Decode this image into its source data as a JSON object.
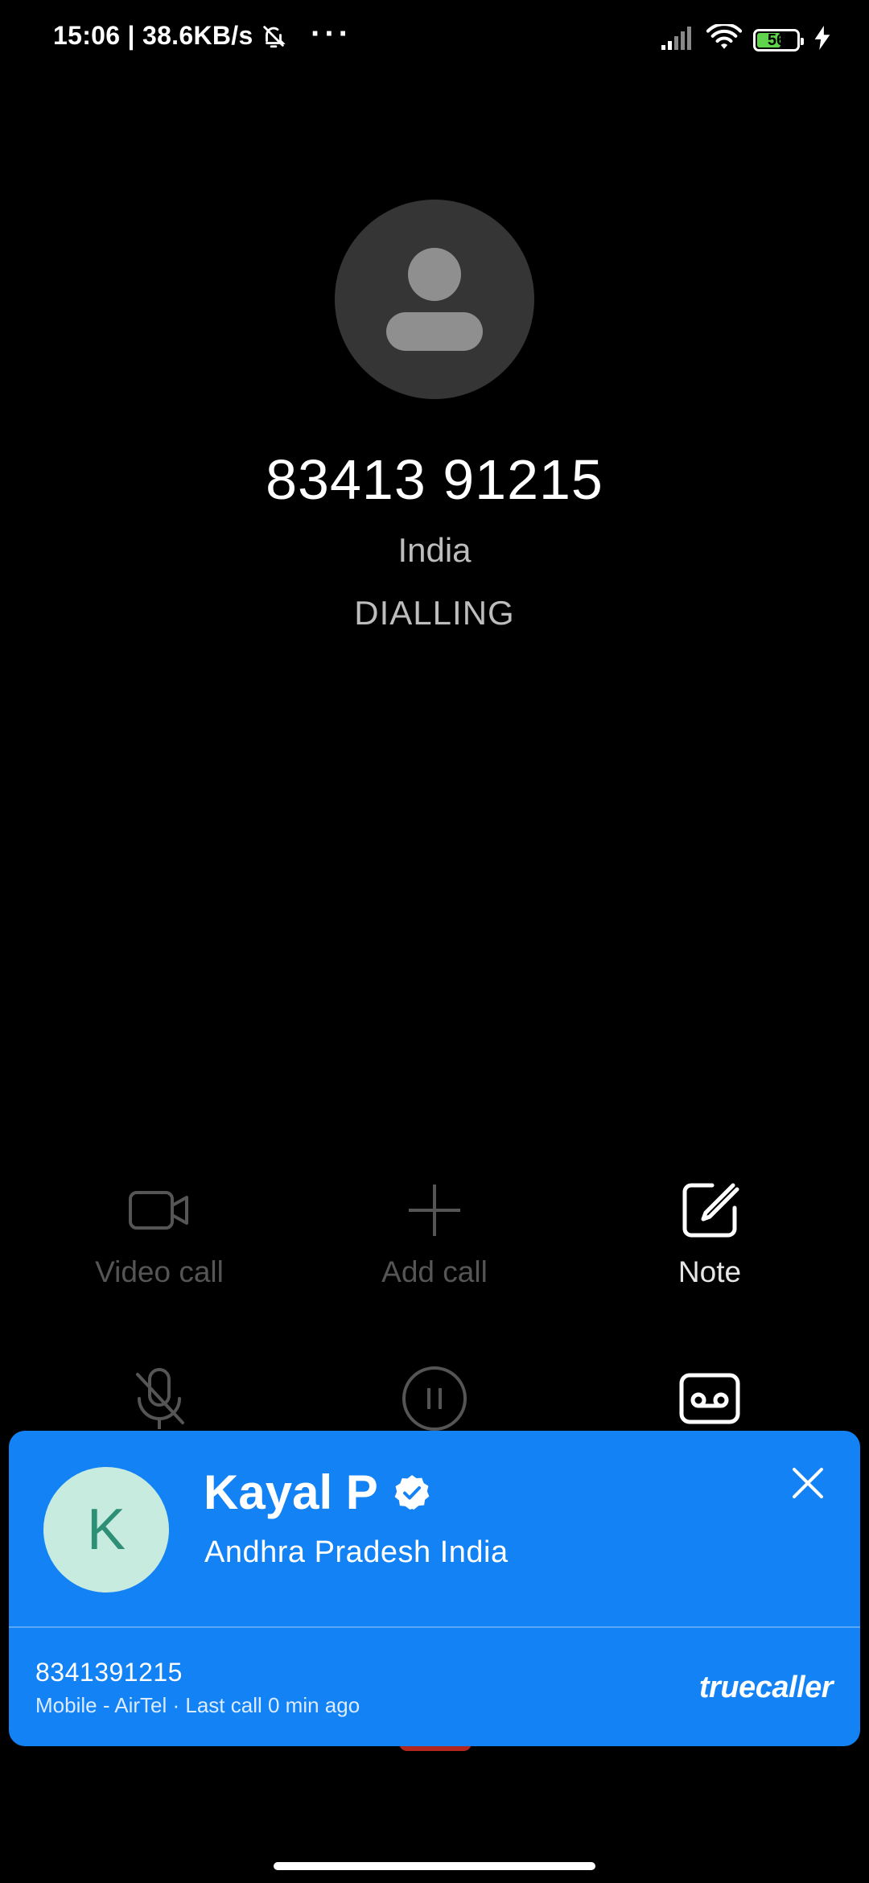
{
  "status_bar": {
    "time_speed": "15:06 | 38.6KB/s",
    "more": "···",
    "battery_level": "56",
    "battery_fraction": 0.56,
    "icons": [
      "bell-off-icon",
      "signal-icon",
      "wifi-icon",
      "battery-icon",
      "charging-icon"
    ]
  },
  "call": {
    "number": "83413 91215",
    "region": "India",
    "status": "DIALLING"
  },
  "controls": {
    "video_call": "Video call",
    "add_call": "Add call",
    "note": "Note"
  },
  "truecaller": {
    "initial": "K",
    "name": "Kayal P",
    "location": "Andhra Pradesh India",
    "number": "8341391215",
    "details": "Mobile - AirTel · Last call 0 min ago",
    "brand": "truecaller",
    "card_color": "#1282f5",
    "avatar_bg": "#c8ebe0",
    "avatar_fg": "#2c8f76"
  }
}
